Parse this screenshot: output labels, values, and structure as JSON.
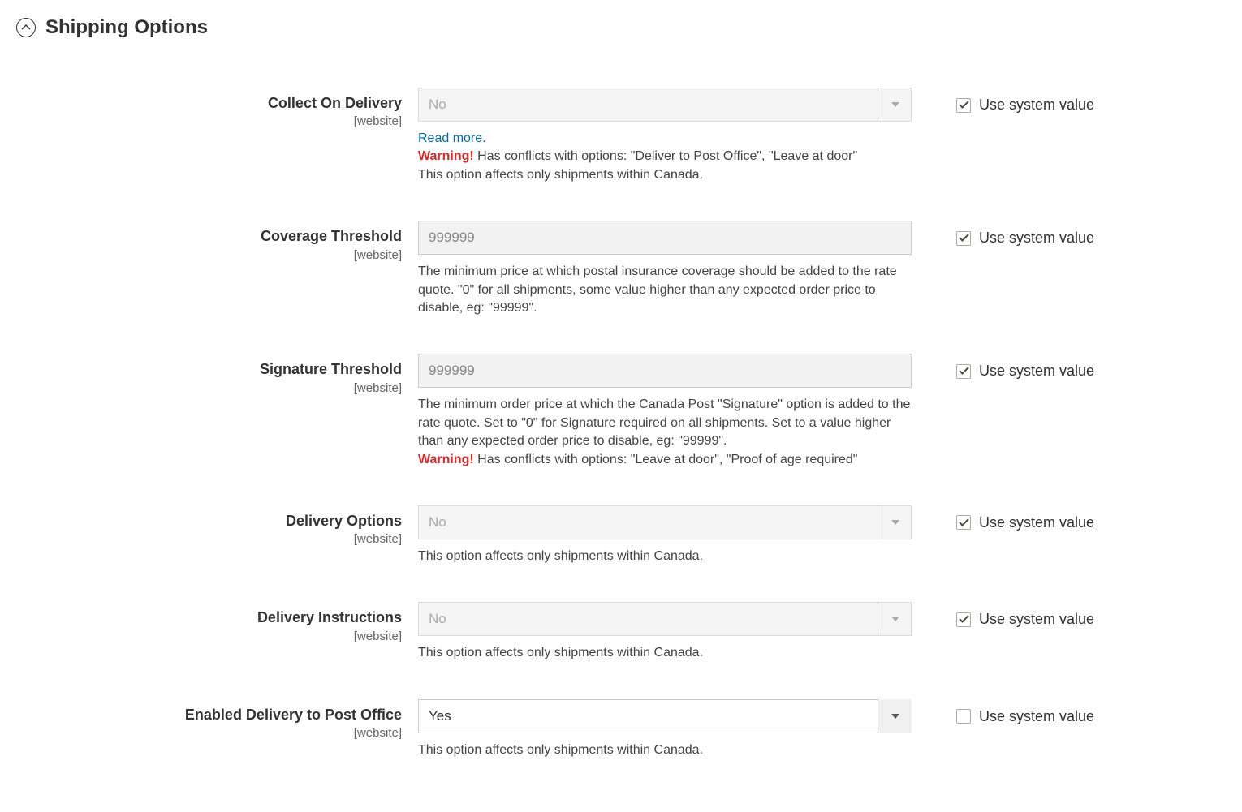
{
  "section": {
    "title": "Shipping Options"
  },
  "common": {
    "scope": "[website]",
    "use_system_value": "Use system value"
  },
  "fields": {
    "collect_on_delivery": {
      "label": "Collect On Delivery",
      "value": "No",
      "read_more": "Read more.",
      "warning_prefix": "Warning!",
      "warning_text": " Has conflicts with options: \"Deliver to Post Office\", \"Leave at door\"",
      "note": "This option affects only shipments within Canada.",
      "use_system": true
    },
    "coverage_threshold": {
      "label": "Coverage Threshold",
      "value": "999999",
      "note": "The minimum price at which postal insurance coverage should be added to the rate quote. \"0\" for all shipments, some value higher than any expected order price to disable, eg: \"99999\".",
      "use_system": true
    },
    "signature_threshold": {
      "label": "Signature Threshold",
      "value": "999999",
      "note": "The minimum order price at which the Canada Post \"Signature\" option is added to the rate quote. Set to \"0\" for Signature required on all shipments. Set to a value higher than any expected order price to disable, eg: \"99999\".",
      "warning_prefix": "Warning!",
      "warning_text": " Has conflicts with options: \"Leave at door\", \"Proof of age required\"",
      "use_system": true
    },
    "delivery_options": {
      "label": "Delivery Options",
      "value": "No",
      "note": "This option affects only shipments within Canada.",
      "use_system": true
    },
    "delivery_instructions": {
      "label": "Delivery Instructions",
      "value": "No",
      "note": "This option affects only shipments within Canada.",
      "use_system": true
    },
    "delivery_to_post_office": {
      "label": "Enabled Delivery to Post Office",
      "value": "Yes",
      "note": "This option affects only shipments within Canada.",
      "use_system": false
    }
  }
}
